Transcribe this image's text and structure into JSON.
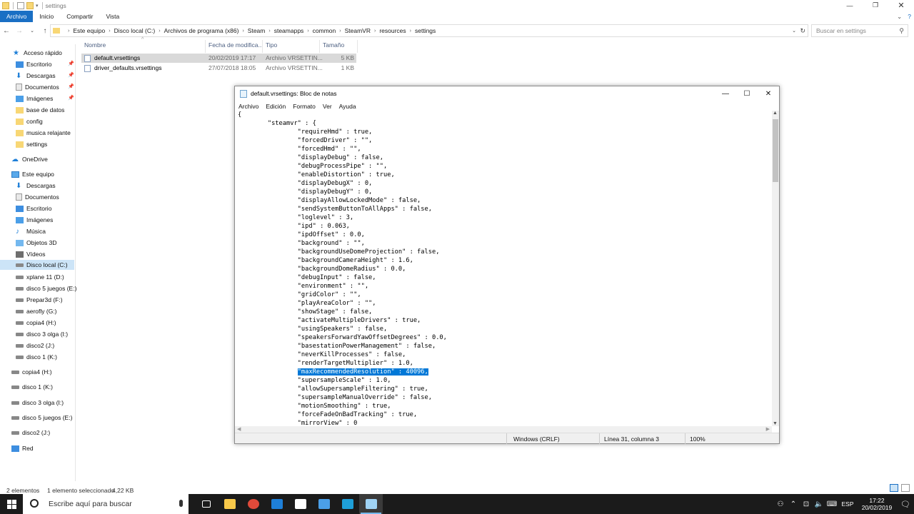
{
  "explorer": {
    "title": "settings",
    "ribbon_tabs": [
      "Archivo",
      "Inicio",
      "Compartir",
      "Vista"
    ],
    "breadcrumb": [
      "Este equipo",
      "Disco local (C:)",
      "Archivos de programa (x86)",
      "Steam",
      "steamapps",
      "common",
      "SteamVR",
      "resources",
      "settings"
    ],
    "search_placeholder": "Buscar en settings",
    "columns": {
      "name": "Nombre",
      "date": "Fecha de modifica...",
      "type": "Tipo",
      "size": "Tamaño"
    },
    "files": [
      {
        "name": "default.vrsettings",
        "date": "20/02/2019 17:17",
        "type": "Archivo VRSETTIN...",
        "size": "5 KB"
      },
      {
        "name": "driver_defaults.vrsettings",
        "date": "27/07/2018 18:05",
        "type": "Archivo VRSETTIN...",
        "size": "1 KB"
      }
    ],
    "sidebar": [
      {
        "label": "Acceso rápido",
        "icon": "star-icon"
      },
      {
        "label": "Escritorio",
        "icon": "desktop-folder-icon"
      },
      {
        "label": "Descargas",
        "icon": "download-icon"
      },
      {
        "label": "Documentos",
        "icon": "document-icon"
      },
      {
        "label": "Imágenes",
        "icon": "image-folder-icon"
      },
      {
        "label": "base de datos",
        "icon": "folder-icon"
      },
      {
        "label": "config",
        "icon": "folder-icon"
      },
      {
        "label": "musica relajante",
        "icon": "folder-icon"
      },
      {
        "label": "settings",
        "icon": "folder-icon"
      },
      {
        "label": "OneDrive",
        "icon": "cloud-icon"
      },
      {
        "label": "Este equipo",
        "icon": "computer-icon"
      },
      {
        "label": "Descargas",
        "icon": "download-icon"
      },
      {
        "label": "Documentos",
        "icon": "document-icon"
      },
      {
        "label": "Escritorio",
        "icon": "desktop-folder-icon"
      },
      {
        "label": "Imágenes",
        "icon": "image-folder-icon"
      },
      {
        "label": "Música",
        "icon": "music-icon"
      },
      {
        "label": "Objetos 3D",
        "icon": "3d-objects-icon"
      },
      {
        "label": "Vídeos",
        "icon": "video-folder-icon"
      },
      {
        "label": "Disco local (C:)",
        "icon": "drive-icon"
      },
      {
        "label": "xplane 11 (D:)",
        "icon": "drive-icon"
      },
      {
        "label": "disco 5 juegos (E:)",
        "icon": "drive-icon"
      },
      {
        "label": "Prepar3d (F:)",
        "icon": "drive-icon"
      },
      {
        "label": "aerofly (G:)",
        "icon": "drive-icon"
      },
      {
        "label": "copia4 (H:)",
        "icon": "drive-icon"
      },
      {
        "label": "disco 3 olga (I:)",
        "icon": "drive-icon"
      },
      {
        "label": "disco2 (J:)",
        "icon": "drive-icon"
      },
      {
        "label": "disco 1 (K:)",
        "icon": "drive-icon"
      },
      {
        "label": "copia4 (H:)",
        "icon": "drive-icon"
      },
      {
        "label": "disco 1 (K:)",
        "icon": "drive-icon"
      },
      {
        "label": "disco 3 olga (I:)",
        "icon": "drive-icon"
      },
      {
        "label": "disco 5 juegos (E:)",
        "icon": "drive-icon"
      },
      {
        "label": "disco2 (J:)",
        "icon": "drive-icon"
      },
      {
        "label": "Red",
        "icon": "network-icon"
      }
    ],
    "status": {
      "count": "2 elementos",
      "selection": "1 elemento seleccionado",
      "selection_size": "4,22 KB"
    }
  },
  "notepad": {
    "title": "default.vrsettings: Bloc de notas",
    "menu": [
      "Archivo",
      "Edición",
      "Formato",
      "Ver",
      "Ayuda"
    ],
    "lines": [
      "{",
      "        \"steamvr\" : {",
      "                \"requireHmd\" : true,",
      "                \"forcedDriver\" : \"\",",
      "                \"forcedHmd\" : \"\",",
      "                \"displayDebug\" : false,",
      "                \"debugProcessPipe\" : \"\",",
      "                \"enableDistortion\" : true,",
      "                \"displayDebugX\" : 0,",
      "                \"displayDebugY\" : 0,",
      "                \"displayAllowLockedMode\" : false,",
      "                \"sendSystemButtonToAllApps\" : false,",
      "                \"loglevel\" : 3,",
      "                \"ipd\" : 0.063,",
      "                \"ipdOffset\" : 0.0,",
      "                \"background\" : \"\",",
      "                \"backgroundUseDomeProjection\" : false,",
      "                \"backgroundCameraHeight\" : 1.6,",
      "                \"backgroundDomeRadius\" : 0.0,",
      "                \"debugInput\" : false,",
      "                \"environment\" : \"\",",
      "                \"gridColor\" : \"\",",
      "                \"playAreaColor\" : \"\",",
      "                \"showStage\" : false,",
      "                \"activateMultipleDrivers\" : true,",
      "                \"usingSpeakers\" : false,",
      "                \"speakersForwardYawOffsetDegrees\" : 0.0,",
      "                \"basestationPowerManagement\" : false,",
      "                \"neverKillProcesses\" : false,",
      "                \"renderTargetMultiplier\" : 1.0,",
      "                \"maxRecommendedResolution\" : 40096,",
      "                \"supersampleScale\" : 1.0,",
      "                \"allowSupersampleFiltering\" : true,",
      "                \"supersampleManualOverride\" : false,",
      "                \"motionSmoothing\" : true,",
      "                \"forceFadeOnBadTracking\" : true,",
      "                \"mirrorView\" : 0"
    ],
    "highlight_line": 30,
    "status": {
      "line_ending": "Windows (CRLF)",
      "position": "Línea 31, columna 3",
      "zoom": "100%"
    }
  },
  "taskbar": {
    "search_placeholder": "Escribe aquí para buscar",
    "language": "ESP",
    "time": "17:22",
    "date": "20/02/2019",
    "apps": [
      {
        "name": "task-view-icon",
        "color": "#ffffff"
      },
      {
        "name": "file-explorer-icon",
        "color": "#f8c94a"
      },
      {
        "name": "chrome-icon",
        "color": "#e04a3a"
      },
      {
        "name": "app-icon",
        "color": "#1e7fd8"
      },
      {
        "name": "vr-headset-icon",
        "color": "#ffffff"
      },
      {
        "name": "app-icon",
        "color": "#4b9fe8"
      },
      {
        "name": "app-icon",
        "color": "#1e9fd8"
      },
      {
        "name": "notepad-icon",
        "color": "#9fd3f5"
      }
    ]
  }
}
